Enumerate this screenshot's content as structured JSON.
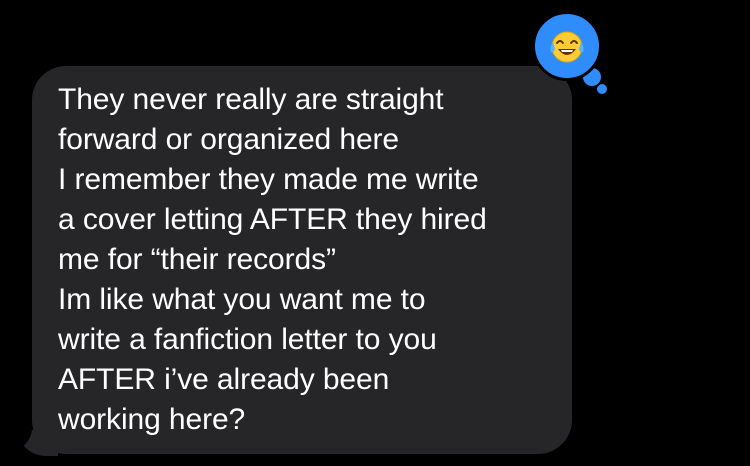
{
  "message": {
    "lines": [
      "They never really are straight",
      "forward or organized here",
      "I remember they made me write",
      "a cover letting AFTER they hired",
      "me for “their records”",
      "Im like what you want me to",
      "write a fanfiction letter to you",
      "AFTER i’ve already been",
      "working here?"
    ],
    "text": "They never really are straight\nforward or organized here\nI remember they made me write\na cover letting AFTER they hired\nme for “their records”\nIm like what you want me to\nwrite a fanfiction letter to you\nAFTER i’ve already been\nworking here?"
  },
  "tapback": {
    "icon": "tears-of-joy-emoji-icon",
    "color": "#2f8dfb"
  },
  "colors": {
    "background": "#000000",
    "bubble": "#262628",
    "text": "#ffffff"
  }
}
